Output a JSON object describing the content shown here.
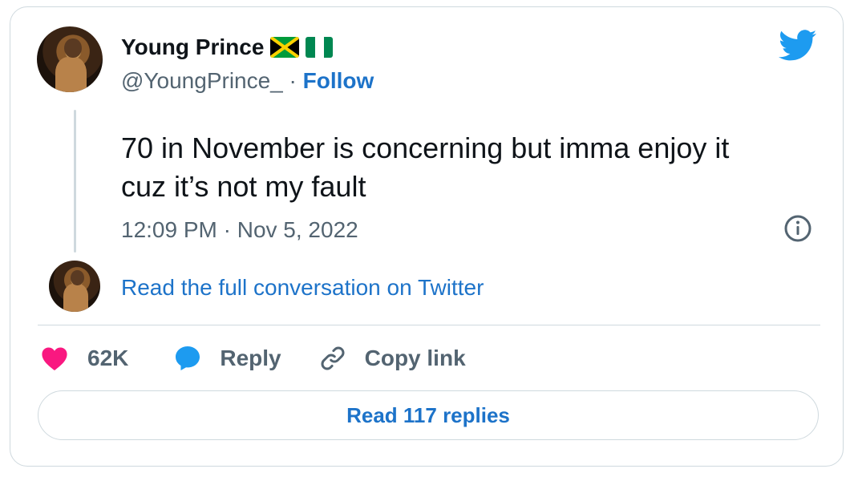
{
  "author": {
    "name": "Young Prince",
    "handle": "@YoungPrince_",
    "separator": "·",
    "follow_label": "Follow",
    "flags": [
      "jamaica-flag",
      "nigeria-flag"
    ]
  },
  "tweet": {
    "text_line1": "70 in November is concerning but imma enjoy it",
    "text_line2": "cuz it’s not my fault",
    "timestamp": "12:09 PM · Nov 5, 2022"
  },
  "conversation_link": "Read the full conversation on Twitter",
  "actions": {
    "likes": "62K",
    "reply_label": "Reply",
    "copy_link_label": "Copy link"
  },
  "read_replies_label": "Read 117 replies",
  "colors": {
    "accent": "#1d73c9",
    "twitter_blue": "#1d9bf0",
    "like_pink": "#f91880",
    "muted": "#536471",
    "border": "#cfd9de"
  },
  "icons": [
    "twitter-bird-icon",
    "info-icon",
    "heart-icon",
    "reply-bubble-icon",
    "link-icon"
  ]
}
